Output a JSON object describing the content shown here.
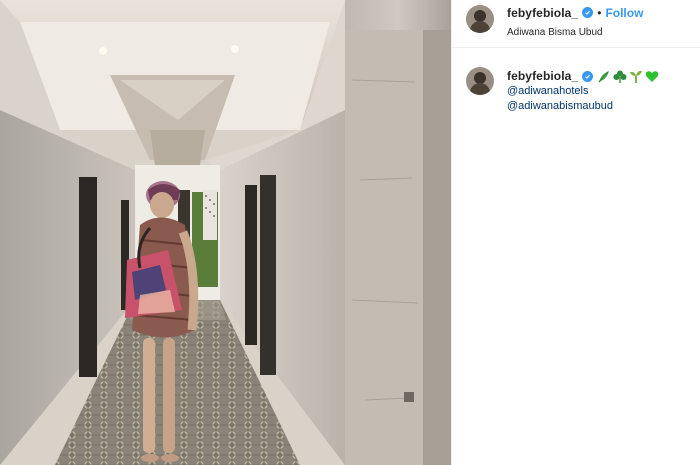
{
  "post": {
    "photo_alt": "",
    "colors": {
      "follow": "#3897f0",
      "mention": "#003569",
      "verified": "#3897f0",
      "heart": "#2ec02e"
    }
  },
  "header": {
    "username": "febyfebiola_",
    "dot": "•",
    "follow_label": "Follow",
    "location": "Adiwana Bisma Ubud"
  },
  "caption": {
    "username": "febyfebiola_",
    "emojis": [
      "herb-icon",
      "shamrock-icon",
      "seedling-icon",
      "green-heart-icon"
    ],
    "mentions": [
      "@adiwanahotels",
      "@adiwanabismaubud"
    ]
  }
}
